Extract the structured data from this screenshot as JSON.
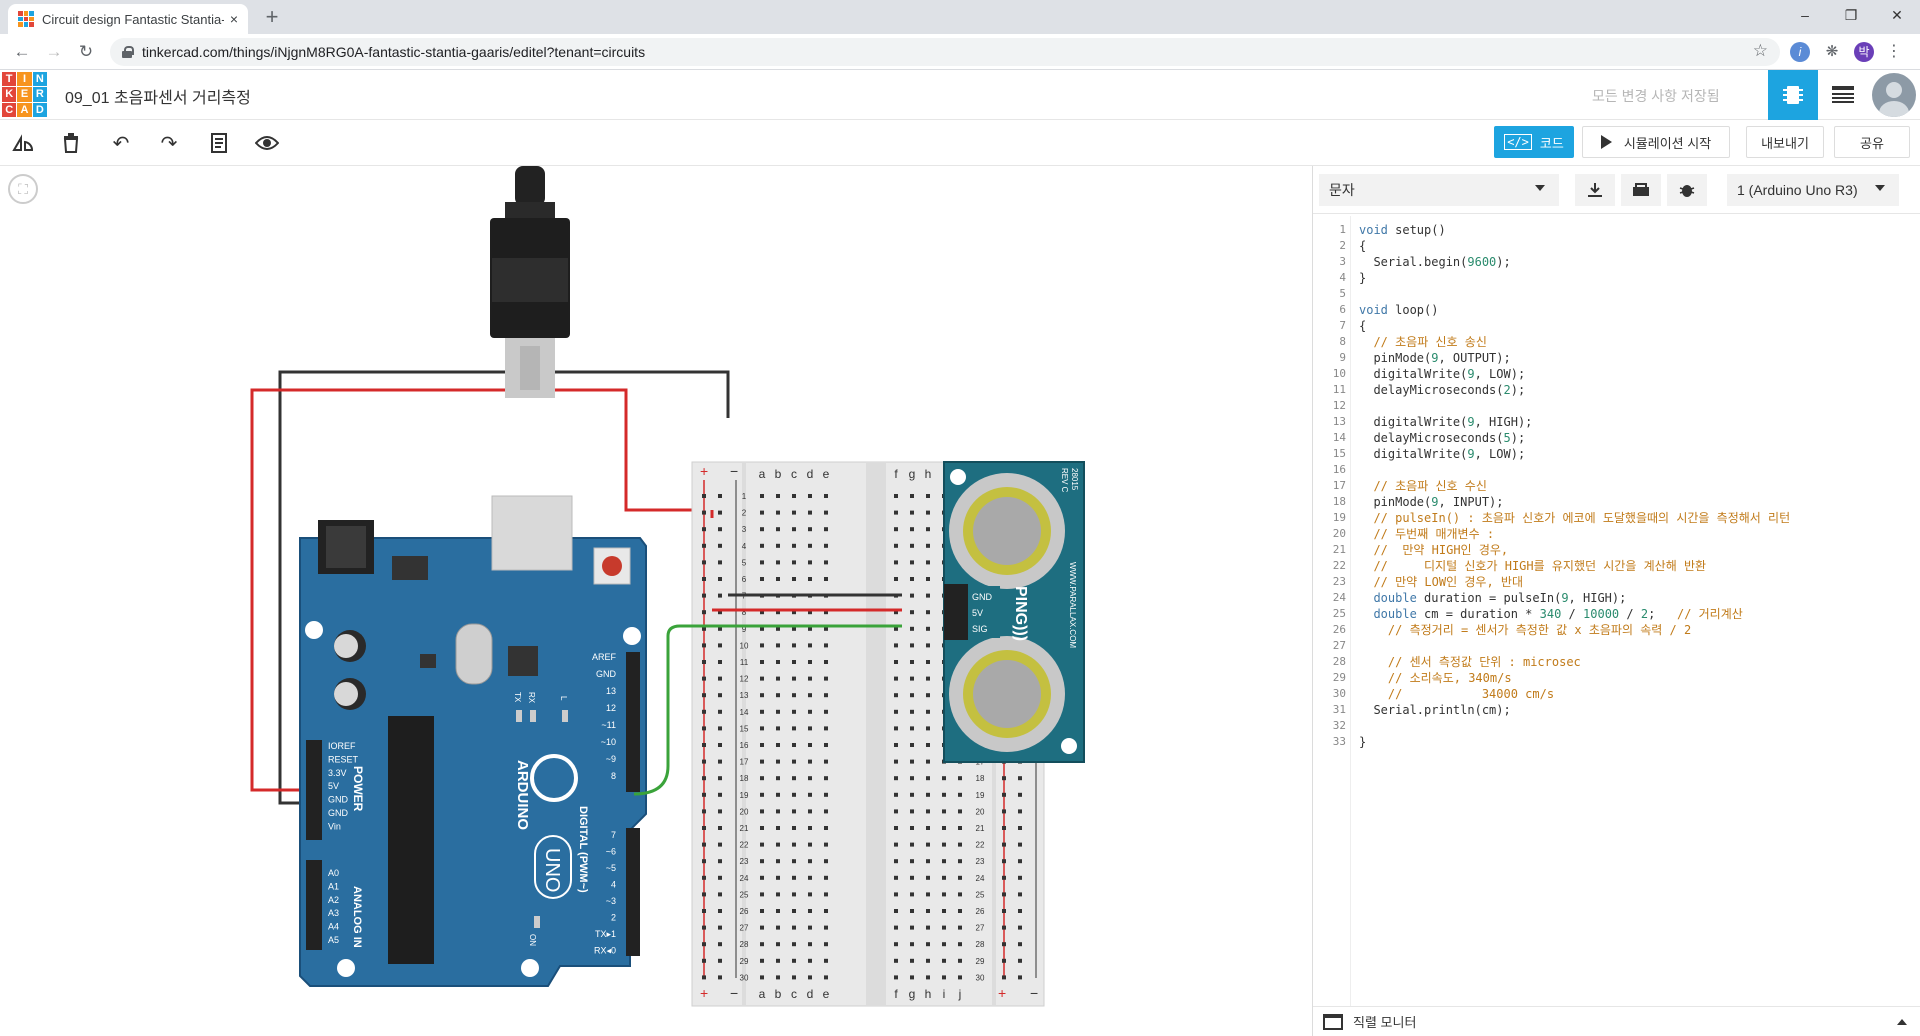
{
  "browser": {
    "tab_title": "Circuit design Fantastic Stantia-",
    "tab_close": "×",
    "new_tab": "+",
    "url": "tinkercad.com/things/iNjgnM8RG0A-fantastic-stantia-gaaris/editel?tenant=circuits",
    "window_controls": [
      "–",
      "❐",
      "✕"
    ],
    "profile_initial": "박"
  },
  "header": {
    "logo_letters": [
      "T",
      "I",
      "N",
      "K",
      "E",
      "R",
      "C",
      "A",
      "D"
    ],
    "logo_colors": [
      "#e2463a",
      "#f7941e",
      "#1da4e0",
      "#e2463a",
      "#f7941e",
      "#1da4e0",
      "#e2463a",
      "#f7941e",
      "#1da4e0"
    ],
    "project_title": "09_01 초음파센서 거리측정",
    "save_status": "모든 변경 사항 저장됨"
  },
  "toolbar": {
    "code_label": "코드",
    "simulate_label": "시뮬레이션 시작",
    "export_label": "내보내기",
    "share_label": "공유"
  },
  "code_panel": {
    "mode": "문자",
    "device": "1 (Arduino Uno R3)",
    "serial_monitor_label": "직렬 모니터",
    "lines": [
      "void setup()",
      "{",
      "  Serial.begin(9600);",
      "}",
      "",
      "void loop()",
      "{",
      "  // 초음파 신호 송신",
      "  pinMode(9, OUTPUT);",
      "  digitalWrite(9, LOW);",
      "  delayMicroseconds(2);",
      "",
      "  digitalWrite(9, HIGH);",
      "  delayMicroseconds(5);",
      "  digitalWrite(9, LOW);",
      "",
      "  // 초음파 신호 수신",
      "  pinMode(9, INPUT);",
      "  // pulseIn() : 초음파 신호가 에코에 도달했을때의 시간을 측정해서 리턴",
      "  // 두번째 매개변수 :",
      "  //  만약 HIGH인 경우,",
      "  //     디지털 신호가 HIGH를 유지했던 시간을 계산해 반환",
      "  // 만약 LOW인 경우, 반대",
      "  double duration = pulseIn(9, HIGH);",
      "  double cm = duration * 340 / 10000 / 2;   // 거리계산",
      "    // 측정거리 = 센서가 측정한 값 x 초음파의 속력 / 2",
      "",
      "    // 센서 측정값 단위 : microsec",
      "    // 소리속도, 340m/s",
      "    //           34000 cm/s",
      "  Serial.println(cm);",
      "",
      "}"
    ]
  },
  "circuit": {
    "arduino": {
      "brand": "ARDUINO",
      "model": "UNO",
      "power_label": "POWER",
      "analog_label": "ANALOG IN",
      "digital_label": "DIGITAL (PWM~)",
      "on_label": "ON",
      "tx_label": "TX",
      "rx_label": "RX",
      "l_label": "L",
      "power_pins": [
        "IOREF",
        "RESET",
        "3.3V",
        "5V",
        "GND",
        "GND",
        "Vin"
      ],
      "analog_pins": [
        "A0",
        "A1",
        "A2",
        "A3",
        "A4",
        "A5"
      ],
      "digital_pins_top": [
        "AREF",
        "GND",
        "13",
        "12",
        "~11",
        "~10",
        "~9",
        "8"
      ],
      "digital_pins_bottom": [
        "7",
        "~6",
        "~5",
        "4",
        "~3",
        "2",
        "TX▸1",
        "RX◂0"
      ]
    },
    "sensor": {
      "name": "PING)))",
      "website": "WWW.PARALLAX.COM",
      "part": "28015",
      "rev": "REV C",
      "pins": [
        "GND",
        "5V",
        "SIG"
      ]
    },
    "breadboard": {
      "cols_left": [
        "a",
        "b",
        "c",
        "d",
        "e"
      ],
      "cols_right": [
        "f",
        "g",
        "h",
        "i",
        "j"
      ],
      "plus": "+",
      "minus": "−"
    },
    "wire_colors": {
      "black": "#333333",
      "red": "#d42a2a",
      "green": "#3aa33a"
    }
  }
}
